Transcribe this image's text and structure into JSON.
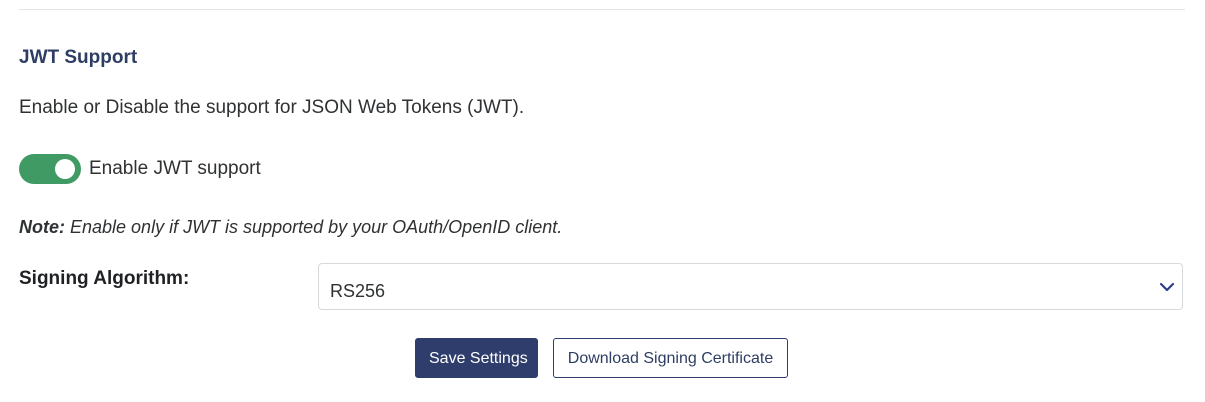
{
  "section": {
    "title": "JWT Support",
    "description": "Enable or Disable the support for JSON Web Tokens (JWT)."
  },
  "toggle": {
    "label": "Enable JWT support",
    "enabled": true,
    "color": "#3f9a63"
  },
  "note": {
    "label": "Note:",
    "text": " Enable only if JWT is supported by your OAuth/OpenID client."
  },
  "signing": {
    "label": "Signing Algorithm:",
    "selected_value": "RS256",
    "icon": "chevron-down-icon"
  },
  "actions": {
    "save_label": "Save Settings",
    "download_label": "Download Signing Certificate"
  },
  "colors": {
    "primary": "#2e3d6b",
    "title": "#2e3d63"
  }
}
